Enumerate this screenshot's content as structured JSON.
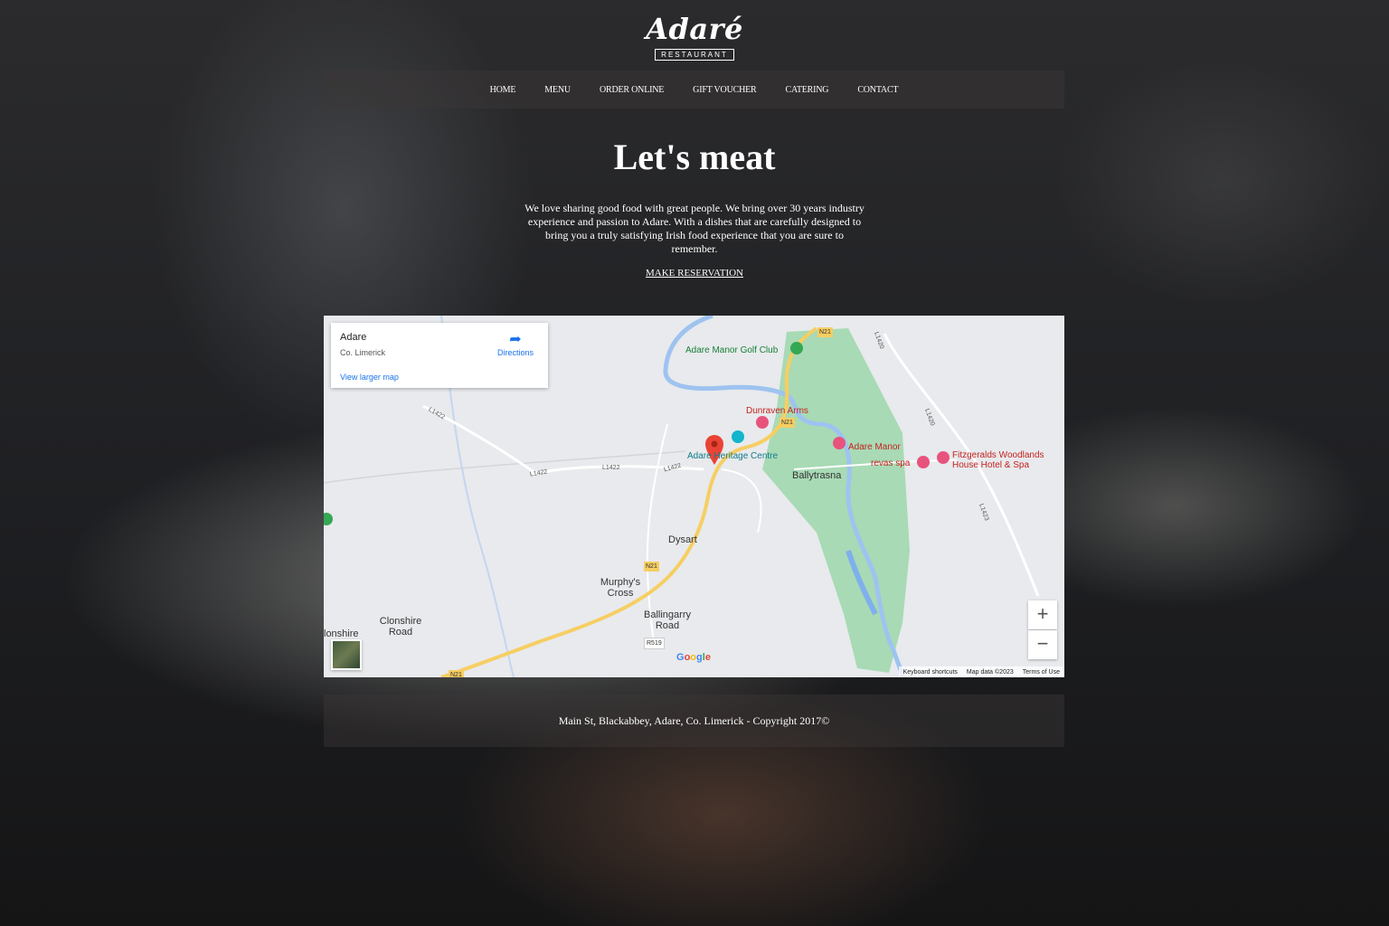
{
  "logo": {
    "script": "Adaré",
    "sub": "RESTAURANT"
  },
  "nav": [
    "HOME",
    "MENU",
    "ORDER ONLINE",
    "GIFT VOUCHER",
    "CATERING",
    "CONTACT"
  ],
  "hero": {
    "title": "Let's meat",
    "text": "We love sharing good food with great people. We bring over 30 years industry experience and passion to Adare. With a dishes that are carefully designed to bring you a truly satisfying Irish food experience that you are sure to remember.",
    "cta": "MAKE RESERVATION"
  },
  "map": {
    "card": {
      "name": "Adare",
      "address": "Co. Limerick",
      "directions": "Directions",
      "larger_map": "View larger map"
    },
    "labels": {
      "golf": "Adare Manor Golf Club",
      "dunraven": "Dunraven Arms",
      "heritage": "Adare Heritage Centre",
      "manor": "Adare Manor",
      "revas": "revas spa",
      "fitzgeralds": "Fitzgeralds Woodlands House Hotel & Spa",
      "ballytrasna": "Ballytrasna",
      "dysart": "Dysart",
      "murphys": "Murphy's Cross",
      "ballingarry": "Ballingarry Road",
      "clonshire": "Clonshire Road",
      "lonshire": "lonshire",
      "roads": {
        "n21": "N21",
        "l1422": "L1422",
        "l1420": "L1420",
        "l1423": "L1423",
        "r519": "R519"
      }
    },
    "zoom_in": "+",
    "zoom_out": "−",
    "footer": {
      "shortcuts": "Keyboard shortcuts",
      "data": "Map data ©2023",
      "terms": "Terms of Use"
    },
    "google": [
      "G",
      "o",
      "o",
      "g",
      "l",
      "e"
    ]
  },
  "footer": "Main St, Blackabbey, Adare, Co. Limerick - Copyright 2017©"
}
